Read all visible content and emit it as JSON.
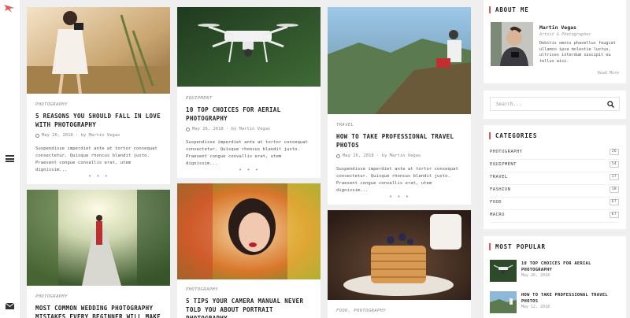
{
  "posts": [
    {
      "category": "PHOTOGRAPHY",
      "title": "5 REASONS YOU SHOULD FALL IN LOVE WITH PHOTOGRAPHY",
      "meta": "May 26, 2018 · by Martin Vegas",
      "excerpt": "Suspendisse imperdiet ante at tortor consequat consectetur. Quisque rhoncus blandit justo. Praesent congue convallis erat, utem dignissim...",
      "more": "• • •"
    },
    {
      "category": "EQUIPMENT",
      "title": "10 TOP CHOICES FOR AERIAL PHOTOGRAPHY",
      "meta": "May 26, 2018 · by Martin Vegas",
      "excerpt": "Suspendisse imperdiet ante at tortor consequat consectetur. Quisque rhoncus blandit justo. Praesent congue convallis erat, utem dignissim...",
      "more": "• • •"
    },
    {
      "category": "TRAVEL",
      "title": "HOW TO TAKE PROFESSIONAL TRAVEL PHOTOS",
      "meta": "May 26, 2018 · by Martin Vegas",
      "excerpt": "Suspendisse imperdiet ante at tortor consequat consectetur. Quisque rhoncus blandit justo. Praesent congue convallis erat, utem dignissim...",
      "more": "• • •"
    },
    {
      "category": "PHOTOGRAPHY",
      "title": "MOST COMMON WEDDING PHOTOGRAPHY MISTAKES EVERY BEGINNER WILL MAKE"
    },
    {
      "category": "PHOTOGRAPHY",
      "title": "5 TIPS YOUR CAMERA MANUAL NEVER TOLD YOU ABOUT PORTRAIT PHOTOGRAPHY"
    },
    {
      "category": "FOOD, PHOTOGRAPHY"
    }
  ],
  "about": {
    "title": "ABOUT ME",
    "name": "Martin Vegas",
    "role": "Artist & Photographer",
    "text": "Debitis omnis phasellus feugiat ullamco ipsa molestie luctus, ultrices interdum suscipit eu tellus wisi.",
    "read_more": "Read More"
  },
  "search": {
    "placeholder": "Search..."
  },
  "categories": {
    "title": "CATEGORIES",
    "items": [
      {
        "label": "PHOTOGRAPHY",
        "count": "26"
      },
      {
        "label": "EQUIPMENT",
        "count": "54"
      },
      {
        "label": "TRAVEL",
        "count": "17"
      },
      {
        "label": "FASHION",
        "count": "18"
      },
      {
        "label": "FOOD",
        "count": "67"
      },
      {
        "label": "MACRO",
        "count": "67"
      }
    ]
  },
  "popular": {
    "title": "MOST POPULAR",
    "items": [
      {
        "title": "10 TOP CHOICES FOR AERIAL PHOTOGRAPHY",
        "date": "May 26, 2018"
      },
      {
        "title": "HOW TO TAKE PROFESSIONAL TRAVEL PHOTOS",
        "date": "May 12, 2018"
      }
    ]
  },
  "colors": {
    "accent": "#e85454",
    "background": "#efefef",
    "card": "#ffffff"
  },
  "icons": {
    "logo": "bird-logo-icon",
    "menu": "hamburger-menu-icon",
    "mail": "envelope-icon",
    "search": "search-icon",
    "clock": "clock-icon"
  }
}
